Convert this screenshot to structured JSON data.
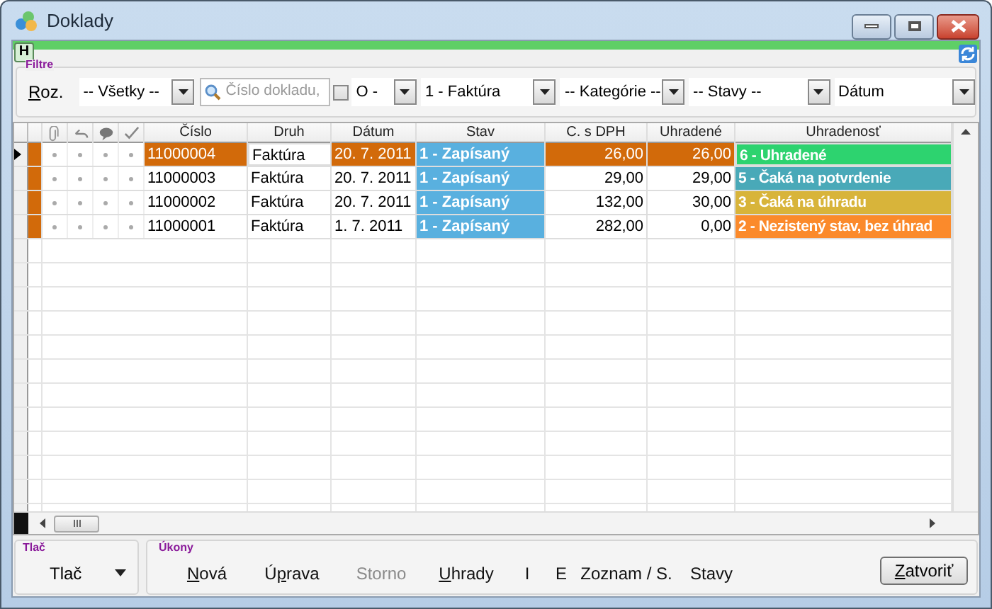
{
  "window": {
    "title": "Doklady"
  },
  "toolbar": {
    "h_button": "H"
  },
  "filters": {
    "title": "Filtre",
    "roz": {
      "label": "Roz."
    },
    "scope": "-- Všetky --",
    "search": {
      "placeholder": "Číslo dokladu,"
    },
    "o_checked": false,
    "o_value": "O -",
    "doc_type": "1 - Faktúra",
    "category": "-- Kategórie --",
    "states": "-- Stavy --",
    "sort": "Dátum"
  },
  "table": {
    "columns": [
      "Číslo",
      "Druh",
      "Dátum",
      "Stav",
      "C. s DPH",
      "Uhradené",
      "Uhradenosť"
    ],
    "rows": [
      {
        "selected": true,
        "number": "11000004",
        "type": "Faktúra",
        "date": "20. 7. 2011",
        "status": "1 - Zapísaný",
        "total": "26,00",
        "paid": "26,00",
        "payment_status": "6 - Uhradené",
        "color": "#2dd36f"
      },
      {
        "selected": false,
        "number": "11000003",
        "type": "Faktúra",
        "date": "20. 7. 2011",
        "status": "1 - Zapísaný",
        "total": "29,00",
        "paid": "29,00",
        "payment_status": "5 - Čaká na potvrdenie",
        "color": "#49a9b8"
      },
      {
        "selected": false,
        "number": "11000002",
        "type": "Faktúra",
        "date": "20. 7. 2011",
        "status": "1 - Zapísaný",
        "total": "132,00",
        "paid": "30,00",
        "payment_status": "3 - Čaká na úhradu",
        "color": "#d8b43a"
      },
      {
        "selected": false,
        "number": "11000001",
        "type": "Faktúra",
        "date": "1. 7. 2011",
        "status": "1 - Zapísaný",
        "total": "282,00",
        "paid": "0,00",
        "payment_status": "2 - Nezistený stav, bez úhrad",
        "color": "#fb8a2b"
      }
    ]
  },
  "print": {
    "title": "Tlač",
    "button": "Tlač"
  },
  "actions": {
    "title": "Úkony",
    "items": [
      {
        "label": "Nová",
        "disabled": false
      },
      {
        "label": "Úprava",
        "disabled": false
      },
      {
        "label": "Storno",
        "disabled": true
      },
      {
        "label": "Uhrady",
        "disabled": false
      },
      {
        "label": "I",
        "disabled": false
      },
      {
        "label": "E",
        "disabled": false
      },
      {
        "label": "Zoznam / S.",
        "disabled": false
      },
      {
        "label": "Stavy",
        "disabled": false
      }
    ]
  },
  "close_button": {
    "label": "Zatvoriť"
  }
}
